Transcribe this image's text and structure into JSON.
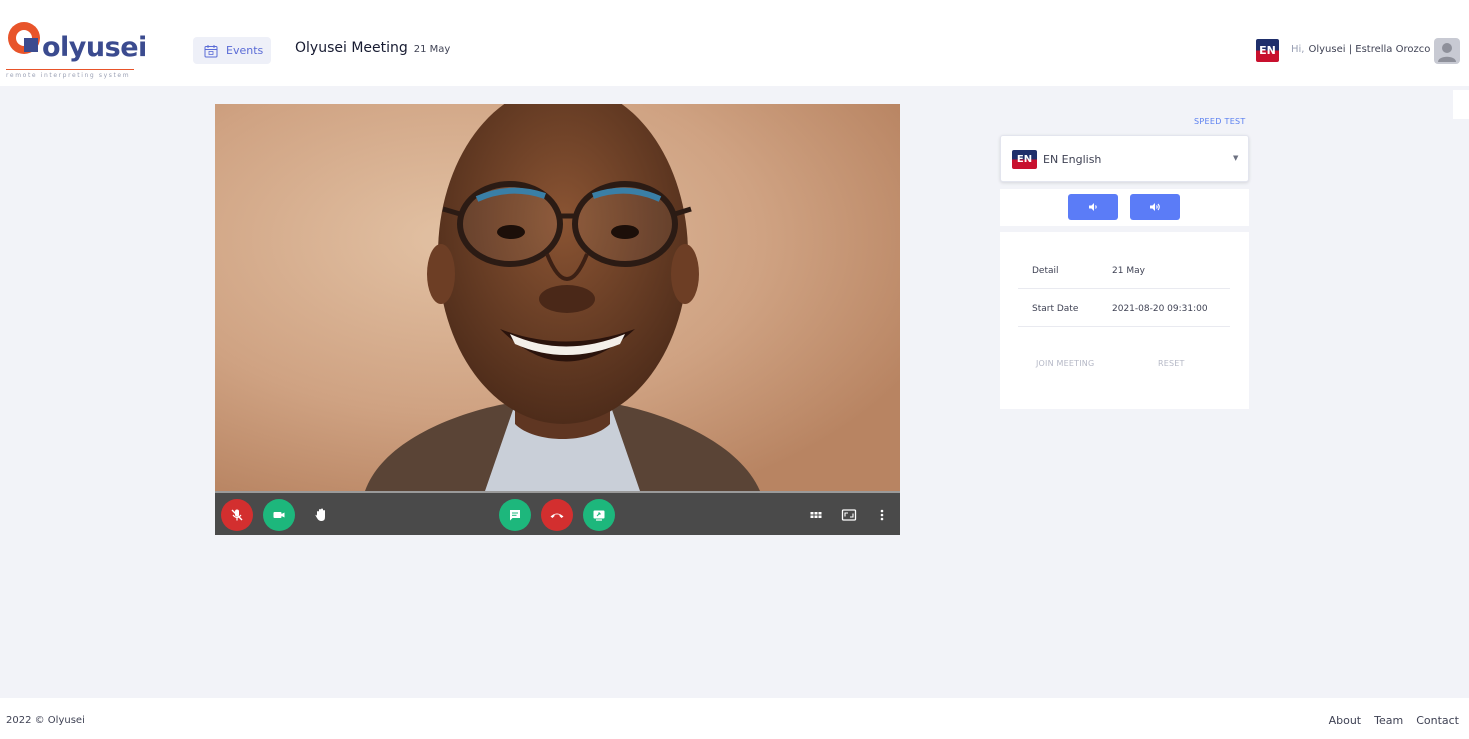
{
  "brand": {
    "name": "olyusei",
    "tagline": "remote interpreting system"
  },
  "header": {
    "events_label": "Events",
    "meeting_name": "Olyusei Meeting",
    "meeting_date": "21 May",
    "flag_code": "EN",
    "greeting_hi": "Hi,",
    "user_name": "Olyusei | Estrella Orozco"
  },
  "video": {
    "toolbar_icons": [
      "mic-off-icon",
      "video-camera-icon",
      "raise-hand-icon",
      "chat-icon",
      "hang-up-icon",
      "screen-share-icon",
      "tile-view-icon",
      "fullscreen-icon",
      "more-options-icon"
    ]
  },
  "panel": {
    "speed_test": "SPEED TEST",
    "language_flag": "EN",
    "language_label": "EN English",
    "detail_label": "Detail",
    "detail_value": "21 May",
    "start_label": "Start Date",
    "start_value": "2021-08-20 09:31:00",
    "join_label": "JOIN MEETING",
    "reset_label": "RESET"
  },
  "footer": {
    "copyright": "2022 © Olyusei",
    "links": [
      "About",
      "Team",
      "Contact"
    ]
  },
  "colors": {
    "accent": "#5b7cf7",
    "brand_orange": "#e8542a",
    "brand_blue": "#3b4b8f",
    "danger": "#d32f2f",
    "success": "#1db77c"
  }
}
